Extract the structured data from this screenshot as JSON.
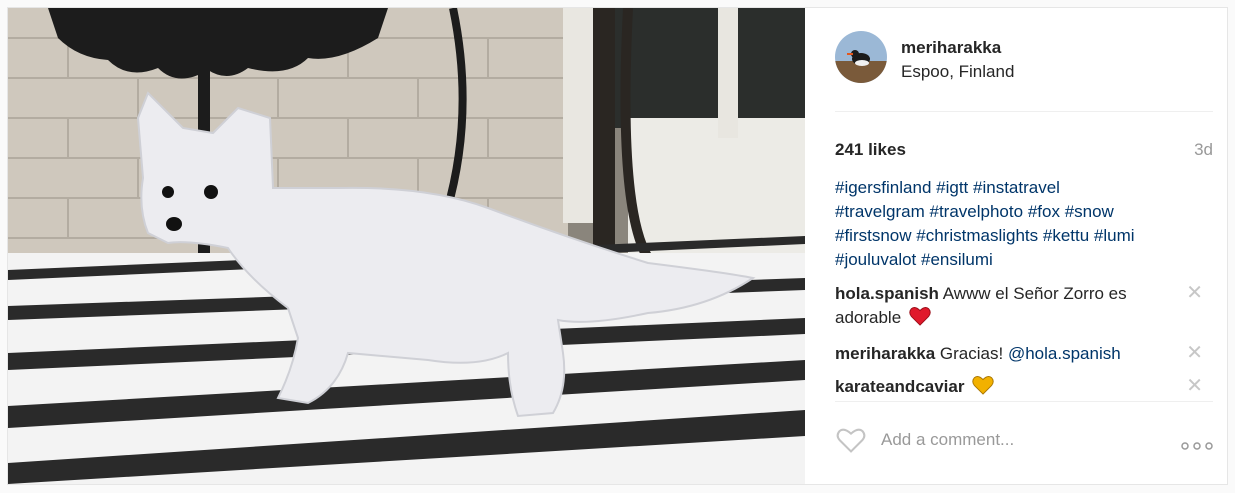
{
  "post": {
    "username": "meriharakka",
    "location": "Espoo, Finland",
    "likes": "241 likes",
    "age": "3d",
    "caption_tags": [
      "#igersfinland",
      "#igtt",
      "#instatravel",
      "#travelgram",
      "#travelphoto",
      "#fox",
      "#snow",
      "#firstsnow",
      "#christmaslights",
      "#kettu",
      "#lumi",
      "#jouluvalot",
      "#ensilumi"
    ]
  },
  "comments": [
    {
      "user": "hola.spanish",
      "text": "Awww el Señor Zorro es adorable",
      "emoji": "red-heart"
    },
    {
      "user": "meriharakka",
      "text": "Gracias!",
      "mention": "@hola.spanish"
    },
    {
      "user": "karateandcaviar",
      "text": "",
      "emoji": "yellow-heart"
    }
  ],
  "remove_glyph": "✕",
  "add_comment": {
    "placeholder": "Add a comment..."
  },
  "colors": {
    "link": "#003569",
    "muted": "#999999",
    "red_heart": "#e0192b",
    "yellow_heart": "#f2b100"
  },
  "icons": {
    "like": "heart-outline-icon",
    "more": "more-options-icon",
    "remove": "close-icon"
  }
}
